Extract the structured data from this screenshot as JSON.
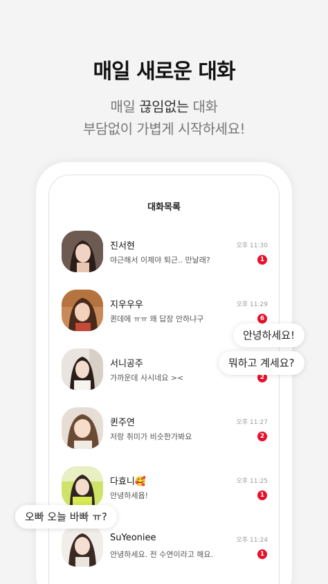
{
  "headline": "매일 새로운 대화",
  "subline1_prefix": "매일 ",
  "subline1_emph": "끊임없는",
  "subline1_suffix": " 대화",
  "subline2": "부담없이 가볍게 시작하세요!",
  "screen_title": "대화목록",
  "chats": [
    {
      "name": "진서현",
      "preview": "야근해서 이제야 퇴근.. 만날래?",
      "time": "오후 11:30",
      "unread": "1"
    },
    {
      "name": "지우우우",
      "preview": "퀸데에 ㅠㅠ 왜 답장 안하냐구",
      "time": "오후 11:29",
      "unread": "6"
    },
    {
      "name": "서니공주",
      "preview": "가까운데 사시네요 ><",
      "time": "",
      "unread": "2"
    },
    {
      "name": "퀸주연",
      "preview": "저랑 취미가 비슷한가봐요",
      "time": "오후 11:27",
      "unread": "2"
    },
    {
      "name": "다효니🥰",
      "preview": "안녕하세욥!",
      "time": "오후 11:25",
      "unread": "1"
    },
    {
      "name": "SuYeoniee",
      "preview": "안녕하세요. 전 수연이라고 해요.",
      "time": "오후 11:24",
      "unread": "1"
    }
  ],
  "bubbles": {
    "hello": "안녕하세요!",
    "what_doing": "뭐하고 계세요?",
    "busy": "오빠 오늘 바빠 ㅠ?"
  },
  "colors": {
    "badge": "#e8102a",
    "background": "#f4f4f4"
  }
}
